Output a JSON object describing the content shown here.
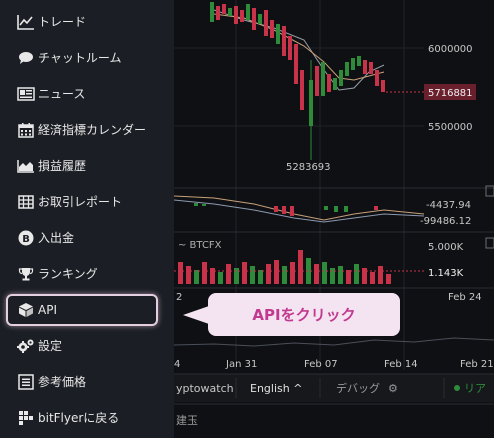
{
  "sidebar": {
    "items": [
      {
        "label": "トレード",
        "icon": "line-chart-icon"
      },
      {
        "label": "チャットルーム",
        "icon": "chat-bubble-icon"
      },
      {
        "label": "ニュース",
        "icon": "newspaper-icon"
      },
      {
        "label": "経済指標カレンダー",
        "icon": "calendar-icon"
      },
      {
        "label": "損益履歴",
        "icon": "area-chart-icon"
      },
      {
        "label": "お取引レポート",
        "icon": "table-icon"
      },
      {
        "label": "入出金",
        "icon": "bitcoin-icon"
      },
      {
        "label": "ランキング",
        "icon": "trophy-icon"
      },
      {
        "label": "API",
        "icon": "cube-icon"
      },
      {
        "label": "設定",
        "icon": "gears-icon"
      },
      {
        "label": "参考価格",
        "icon": "list-icon"
      },
      {
        "label": "bitFlyerに戻る",
        "icon": "bitflyer-logo-icon"
      }
    ]
  },
  "callout": {
    "text": "APIをクリック"
  },
  "chart": {
    "price_axis": {
      "upper": "6000000",
      "current": "5716881",
      "lower": "5500000"
    },
    "low_label": "5283693",
    "indicator_axis": {
      "value1": "-4437.94",
      "value2": "-99486.12"
    },
    "volume": {
      "label": "~ BTCFX",
      "high": "5.000K",
      "current": "1.143K"
    },
    "date_axis": {
      "left_partial": "2",
      "right": "Feb 24"
    },
    "bottom_dates": [
      "4",
      "Jan 31",
      "Feb 07",
      "Feb 14",
      "Feb 21"
    ],
    "footer": {
      "source": "yptowatch",
      "language": "English ^",
      "debug": "デバッグ",
      "right_status": "リア",
      "bottom_label": "建玉"
    }
  },
  "colors": {
    "sidebar_bg": "#1b1e24",
    "chart_bg": "#0f1013",
    "up_candle": "#2e8b3a",
    "down_candle": "#c8334a",
    "callout_bg": "#f4e4f1",
    "callout_text": "#c23a8f",
    "price_badge": "#c8334a"
  }
}
